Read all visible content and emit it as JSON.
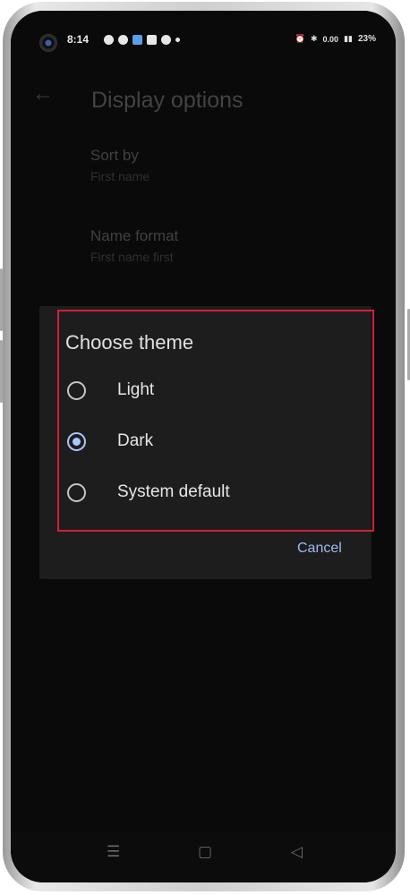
{
  "status_bar": {
    "time": "8:14",
    "left_icons": [
      "media-icon",
      "app-icon",
      "app-icon",
      "app-icon",
      "app-icon",
      "dot-icon"
    ],
    "right_icons": [
      "alarm-icon",
      "bluetooth-icon",
      "data-speed-icon",
      "signal-icon"
    ],
    "net_speed": "0.00",
    "battery": "23%"
  },
  "app_bar": {
    "title": "Display options",
    "back_icon": "arrow-left-icon"
  },
  "preferences": [
    {
      "title": "Sort by",
      "value": "First name"
    },
    {
      "title": "Name format",
      "value": "First name first"
    }
  ],
  "dialog": {
    "title": "Choose theme",
    "options": [
      {
        "label": "Light",
        "selected": false
      },
      {
        "label": "Dark",
        "selected": true
      },
      {
        "label": "System default",
        "selected": false
      }
    ],
    "cancel_label": "Cancel"
  },
  "nav_bar": {
    "icons": [
      "menu-icon",
      "home-icon",
      "back-icon"
    ]
  },
  "colors": {
    "accent": "#a9c7ff",
    "highlight_border": "#d21f3c",
    "dialog_bg": "#1d1d1d"
  }
}
